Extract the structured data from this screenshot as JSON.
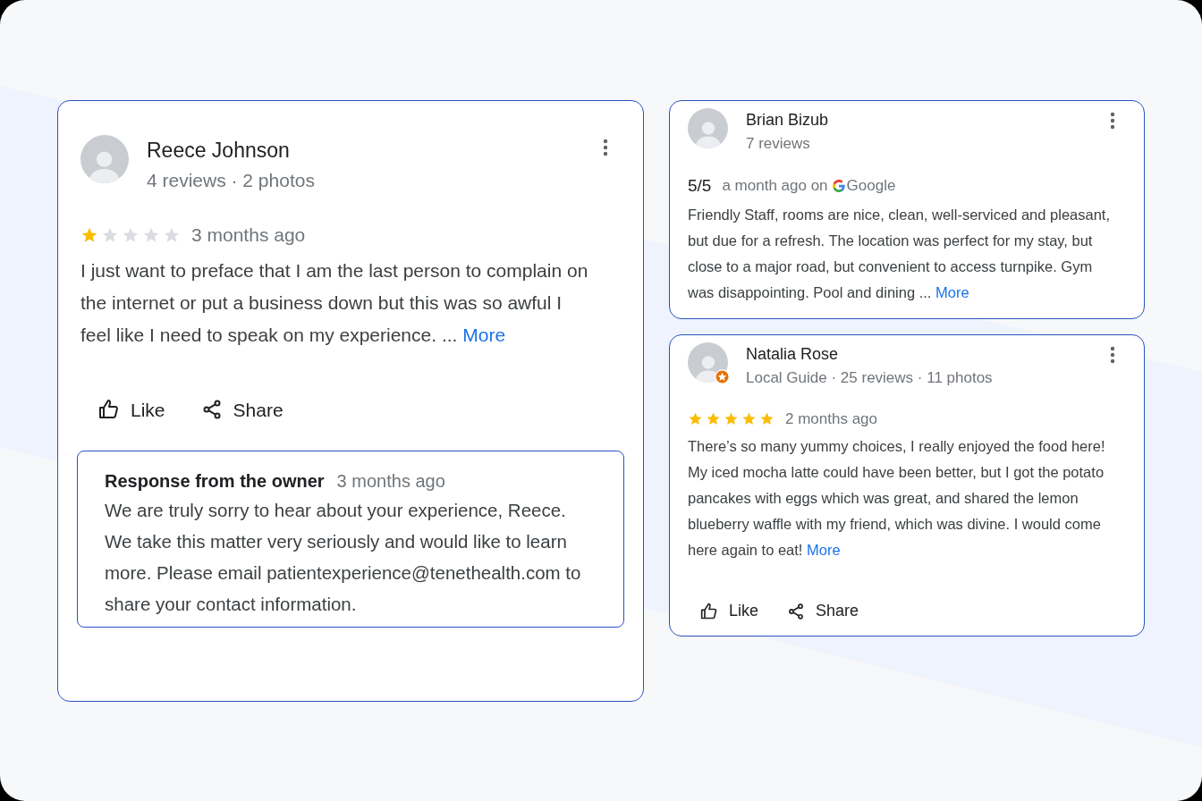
{
  "columns": [
    {
      "reviews": [
        {
          "kind": "stars",
          "name": "Reece Johnson",
          "meta": "4 reviews · 2 photos",
          "badge": false,
          "stars": 1,
          "time": "3 months ago",
          "text": "I just want to preface that I am the last person to complain on the internet or put a business down but this was so awful I feel like I need to speak on my experience. ...",
          "more": "More",
          "actions": [
            "Like",
            "Share"
          ],
          "response": {
            "title": "Response from the owner",
            "time": "3 months ago",
            "text": "We are truly sorry to hear about your experience, Reece.  We take this matter very seriously and would like to learn more.  Please email patientexperience@tenethealth.com to share your contact information."
          }
        }
      ]
    },
    {
      "reviews": [
        {
          "kind": "score",
          "name": "Brian Bizub",
          "meta": "7 reviews",
          "badge": false,
          "score": "5/5",
          "time": "a month ago on",
          "source": "Google",
          "text": "Friendly Staff, rooms are nice, clean, well-serviced and pleasant, but due for a refresh.  The location was perfect for my stay, but close to a major road, but convenient to access turnpike.  Gym was disappointing. Pool and dining ...",
          "more": "More"
        },
        {
          "kind": "stars",
          "name": "Natalia Rose",
          "meta": "Local Guide · 25 reviews · 11 photos",
          "badge": true,
          "stars": 5,
          "time": "2 months ago",
          "text": "There’s so many yummy choices, I really enjoyed the food here! My iced mocha latte could have been better, but I got the potato pancakes with eggs which was great, and shared the lemon blueberry waffle with my friend, which was divine. I would come here again to eat!",
          "more": "More",
          "actions": [
            "Like",
            "Share"
          ]
        }
      ]
    }
  ]
}
